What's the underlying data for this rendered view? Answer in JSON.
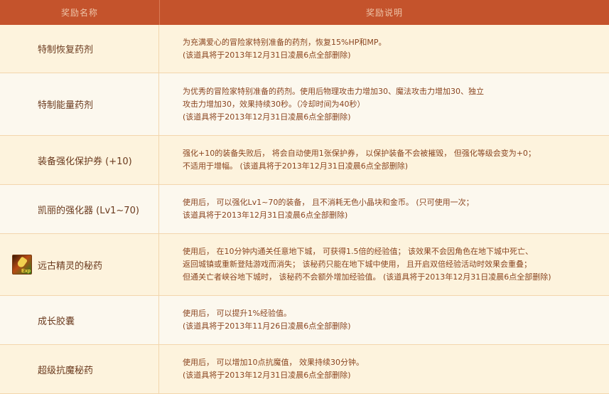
{
  "header": {
    "col_name": "奖励名称",
    "col_desc": "奖励说明"
  },
  "rows": [
    {
      "name": "特制恢复药剂",
      "lines": [
        "为充满爱心的冒险家特别准备的药剂，恢复15%HP和MP。",
        "(该道具将于2013年12月31日凌晨6点全部删除)"
      ]
    },
    {
      "name": "特制能量药剂",
      "lines": [
        "为优秀的冒险家特别准备的药剂。使用后物理攻击力增加30、魔法攻击力增加30、独立",
        "攻击力增加30，效果持续30秒。（冷却时间为40秒）",
        "(该道具将于2013年12月31日凌晨6点全部删除)"
      ]
    },
    {
      "name": "装备强化保护券 (+10)",
      "lines": [
        "强化+10的装备失败后， 将会自动使用1张保护券， 以保护装备不会被摧毁， 但强化等级会变为+0；",
        "不适用于增幅。 (该道具将于2013年12月31日凌晨6点全部删除)"
      ]
    },
    {
      "name": "凯丽的强化器 (Lv1~70)",
      "lines": [
        "使用后， 可以强化Lv1~70的装备， 且不消耗无色小晶块和金币。 (只可使用一次；",
        "该道具将于2013年12月31日凌晨6点全部删除)"
      ]
    },
    {
      "name": "远古精灵的秘药",
      "icon": "exp-potion-icon",
      "icon_text": "Exp",
      "lines": [
        "使用后， 在10分钟内通关任意地下城， 可获得1.5倍的经验值； 该效果不会因角色在地下城中死亡、",
        "返回城镇或重新登陆游戏而消失； 该秘药只能在地下城中使用， 且开启双倍经验活动时效果会重叠；",
        "但通关亡者峡谷地下城时， 该秘药不会额外增加经验值。 (该道具将于2013年12月31日凌晨6点全部删除)"
      ]
    },
    {
      "name": "成长胶囊",
      "lines": [
        "使用后， 可以提升1%经验值。",
        "(该道具将于2013年11月26日凌晨6点全部删除)"
      ]
    },
    {
      "name": "超级抗魔秘药",
      "lines": [
        "使用后， 可以增加10点抗魔值， 效果持续30分钟。",
        "(该道具将于2013年12月31日凌晨6点全部删除)"
      ]
    }
  ]
}
